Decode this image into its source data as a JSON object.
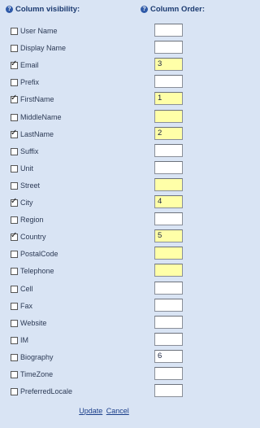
{
  "header": {
    "visibility_label": "Column visibility:",
    "order_label": "Column Order:",
    "help_icon_glyph": "?"
  },
  "rows": [
    {
      "label": "User Name",
      "checked": false,
      "order": "",
      "highlight": false
    },
    {
      "label": "Display Name",
      "checked": false,
      "order": "",
      "highlight": false
    },
    {
      "label": "Email",
      "checked": true,
      "order": "3",
      "highlight": true
    },
    {
      "label": "Prefix",
      "checked": false,
      "order": "",
      "highlight": false
    },
    {
      "label": "FirstName",
      "checked": true,
      "order": "1",
      "highlight": true
    },
    {
      "label": "MiddleName",
      "checked": false,
      "order": "",
      "highlight": true
    },
    {
      "label": "LastName",
      "checked": true,
      "order": "2",
      "highlight": true
    },
    {
      "label": "Suffix",
      "checked": false,
      "order": "",
      "highlight": false
    },
    {
      "label": "Unit",
      "checked": false,
      "order": "",
      "highlight": false
    },
    {
      "label": "Street",
      "checked": false,
      "order": "",
      "highlight": true
    },
    {
      "label": "City",
      "checked": true,
      "order": "4",
      "highlight": true
    },
    {
      "label": "Region",
      "checked": false,
      "order": "",
      "highlight": false
    },
    {
      "label": "Country",
      "checked": true,
      "order": "5",
      "highlight": true
    },
    {
      "label": "PostalCode",
      "checked": false,
      "order": "",
      "highlight": true
    },
    {
      "label": "Telephone",
      "checked": false,
      "order": "",
      "highlight": true
    },
    {
      "label": "Cell",
      "checked": false,
      "order": "",
      "highlight": false
    },
    {
      "label": "Fax",
      "checked": false,
      "order": "",
      "highlight": false
    },
    {
      "label": "Website",
      "checked": false,
      "order": "",
      "highlight": false
    },
    {
      "label": "IM",
      "checked": false,
      "order": "",
      "highlight": false
    },
    {
      "label": "Biography",
      "checked": false,
      "order": "6",
      "highlight": false
    },
    {
      "label": "TimeZone",
      "checked": false,
      "order": "",
      "highlight": false
    },
    {
      "label": "PreferredLocale",
      "checked": false,
      "order": "",
      "highlight": false
    }
  ],
  "footer": {
    "update_label": "Update",
    "cancel_label": "Cancel"
  },
  "colors": {
    "background": "#d9e4f4",
    "highlight_field": "#ffffa8",
    "header_text": "#1b3a70",
    "link": "#1a3e8a"
  }
}
